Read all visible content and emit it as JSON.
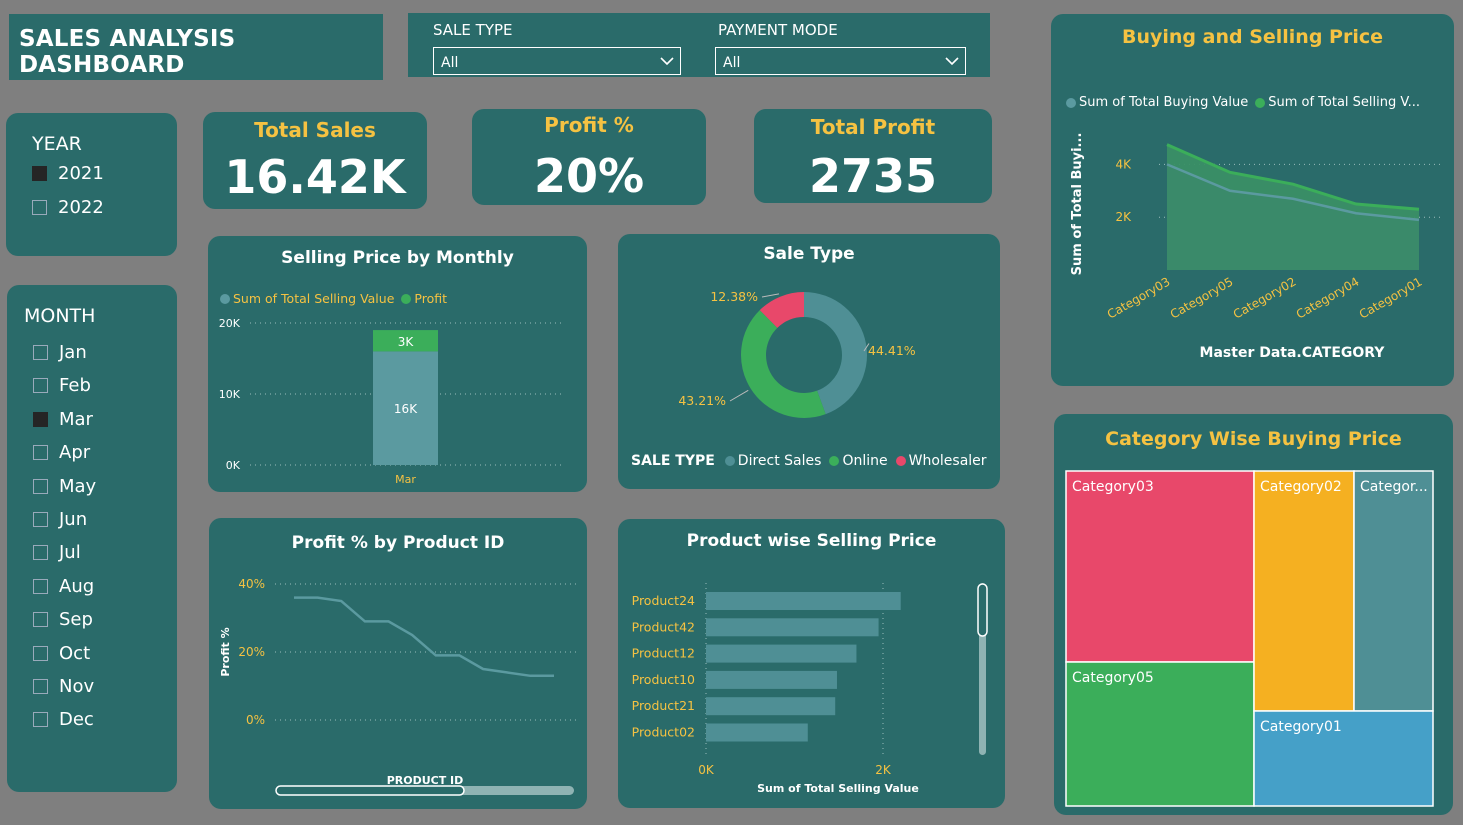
{
  "header": {
    "title": "SALES ANALYSIS DASHBOARD"
  },
  "filters": {
    "sale_type_label": "SALE TYPE",
    "sale_type_value": "All",
    "payment_mode_label": "PAYMENT MODE",
    "payment_mode_value": "All"
  },
  "kpis": [
    {
      "title": "Total Sales",
      "value": "16.42K"
    },
    {
      "title": "Profit %",
      "value": "20%"
    },
    {
      "title": "Total Profit",
      "value": "2735"
    }
  ],
  "year_slicer": {
    "heading": "YEAR",
    "items": [
      {
        "label": "2021",
        "checked": true
      },
      {
        "label": "2022",
        "checked": false
      }
    ]
  },
  "month_slicer": {
    "heading": "MONTH",
    "items": [
      {
        "label": "Jan",
        "checked": false
      },
      {
        "label": "Feb",
        "checked": false
      },
      {
        "label": "Mar",
        "checked": true
      },
      {
        "label": "Apr",
        "checked": false
      },
      {
        "label": "May",
        "checked": false
      },
      {
        "label": "Jun",
        "checked": false
      },
      {
        "label": "Jul",
        "checked": false
      },
      {
        "label": "Aug",
        "checked": false
      },
      {
        "label": "Sep",
        "checked": false
      },
      {
        "label": "Oct",
        "checked": false
      },
      {
        "label": "Nov",
        "checked": false
      },
      {
        "label": "Dec",
        "checked": false
      }
    ]
  },
  "colors": {
    "panel": "#2a6b6a",
    "accent_yellow": "#f5c242",
    "series_blue": "#4f8f95",
    "series_green": "#3bae5a",
    "series_red": "#e8486a",
    "series_orange": "#f5b021",
    "series_sky": "#45a0c8"
  },
  "chart_data": [
    {
      "id": "selling_price_monthly",
      "type": "bar",
      "title": "Selling Price by Monthly",
      "legend": [
        "Sum of Total Selling Value",
        "Profit"
      ],
      "categories": [
        "Mar"
      ],
      "series": [
        {
          "name": "Sum of Total Selling Value",
          "values": [
            16000
          ],
          "label": "16K"
        },
        {
          "name": "Profit",
          "values": [
            3000
          ],
          "label": "3K"
        }
      ],
      "y_ticks": [
        "0K",
        "10K",
        "20K"
      ],
      "ylim": [
        0,
        20000
      ],
      "stacked": true
    },
    {
      "id": "sale_type",
      "type": "pie",
      "title": "Sale Type",
      "legend_title": "SALE TYPE",
      "slices": [
        {
          "name": "Direct Sales",
          "value": 44.41,
          "label": "44.41%"
        },
        {
          "name": "Online",
          "value": 43.21,
          "label": "43.21%"
        },
        {
          "name": "Wholesaler",
          "value": 12.38,
          "label": "12.38%"
        }
      ]
    },
    {
      "id": "buying_selling_price",
      "type": "area",
      "title": "Buying and Selling Price",
      "legend": [
        "Sum of Total Buying Value",
        "Sum of Total Selling V..."
      ],
      "xlabel": "Master Data.CATEGORY",
      "ylabel": "Sum of Total Buyi...",
      "categories": [
        "Category03",
        "Category05",
        "Category02",
        "Category04",
        "Category01"
      ],
      "series": [
        {
          "name": "Sum of Total Buying Value",
          "values": [
            4000,
            3000,
            2700,
            2150,
            1900
          ]
        },
        {
          "name": "Sum of Total Selling Value",
          "values": [
            4750,
            3700,
            3250,
            2500,
            2300
          ]
        }
      ],
      "y_ticks": [
        "2K",
        "4K"
      ],
      "ylim": [
        0,
        5000
      ]
    },
    {
      "id": "profit_by_product",
      "type": "line",
      "title": "Profit % by Product ID",
      "xlabel": "PRODUCT ID",
      "ylabel": "Profit %",
      "values": [
        36,
        36,
        35,
        29,
        29,
        25,
        19,
        19,
        15,
        14,
        13,
        13
      ],
      "y_ticks": [
        "0%",
        "20%",
        "40%"
      ],
      "ylim": [
        0,
        40
      ]
    },
    {
      "id": "product_selling_price",
      "type": "bar",
      "orientation": "horizontal",
      "title": "Product wise Selling Price",
      "xlabel": "Sum of Total Selling Value",
      "categories": [
        "Product24",
        "Product42",
        "Product12",
        "Product10",
        "Product21",
        "Product02"
      ],
      "values": [
        2200,
        1950,
        1700,
        1480,
        1460,
        1150
      ],
      "x_ticks": [
        "0K",
        "2K"
      ],
      "xlim": [
        0,
        2400
      ]
    },
    {
      "id": "category_buying_price",
      "type": "treemap",
      "title": "Category Wise Buying Price",
      "items": [
        {
          "name": "Category03",
          "label": "Category03"
        },
        {
          "name": "Category05",
          "label": "Category05"
        },
        {
          "name": "Category02",
          "label": "Category02"
        },
        {
          "name": "Category04",
          "label": "Categor..."
        },
        {
          "name": "Category01",
          "label": "Category01"
        }
      ]
    }
  ]
}
